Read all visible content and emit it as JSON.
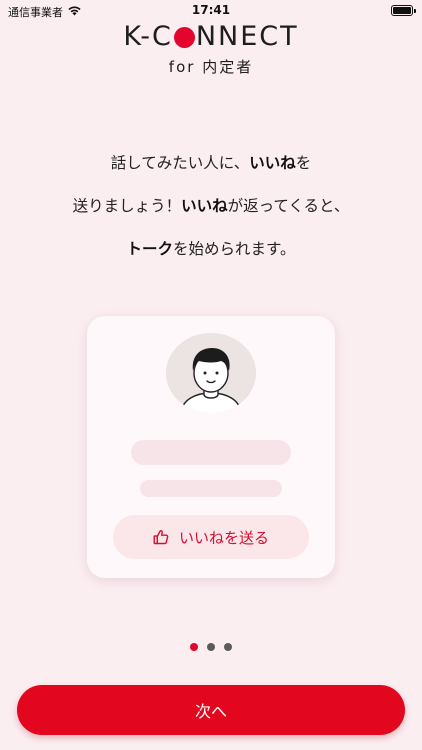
{
  "status_bar": {
    "carrier": "通信事業者",
    "time": "17:41"
  },
  "logo": {
    "part1": "K-C",
    "part2": "NNECT",
    "sub": "for 内定者"
  },
  "message": {
    "line1": [
      {
        "t": "話してみたい人に、",
        "b": false
      },
      {
        "t": "いいね",
        "b": true
      },
      {
        "t": "を",
        "b": false
      }
    ],
    "line2": [
      {
        "t": "送りましょう！",
        "b": false
      },
      {
        "t": "いいね",
        "b": true
      },
      {
        "t": "が返ってくると、",
        "b": false
      }
    ],
    "line3": [
      {
        "t": "トーク",
        "b": true
      },
      {
        "t": "を始められます。",
        "b": false
      }
    ]
  },
  "card": {
    "like_label": "いいねを送る"
  },
  "pager": {
    "total": 3,
    "active": 0
  },
  "next_label": "次へ",
  "colors": {
    "accent": "#e2071f",
    "background": "#fbeef1"
  }
}
